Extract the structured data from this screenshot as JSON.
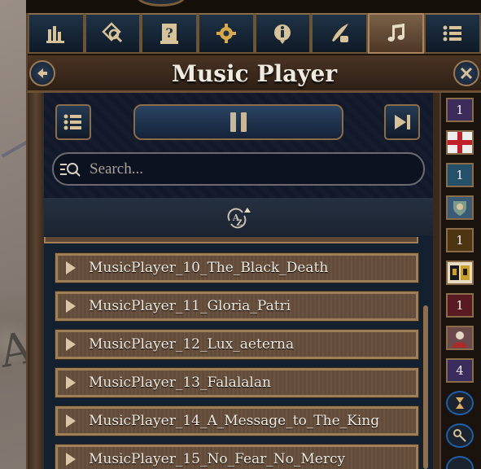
{
  "window": {
    "title": "Music Player"
  },
  "tabs": [
    {
      "name": "ledger",
      "icon": "bar-chart-icon",
      "active": false
    },
    {
      "name": "search-map",
      "icon": "map-search-icon",
      "active": false
    },
    {
      "name": "help",
      "icon": "question-scroll-icon",
      "active": false
    },
    {
      "name": "settings",
      "icon": "gear-icon",
      "active": false
    },
    {
      "name": "info",
      "icon": "info-icon",
      "active": false
    },
    {
      "name": "quill",
      "icon": "quill-ink-icon",
      "active": false
    },
    {
      "name": "music",
      "icon": "music-note-icon",
      "active": true
    },
    {
      "name": "menu",
      "icon": "list-icon",
      "active": false
    }
  ],
  "search": {
    "placeholder": "Search..."
  },
  "tracks": [
    "MusicPlayer_10_The_Black_Death",
    "MusicPlayer_11_Gloria_Patri",
    "MusicPlayer_12_Lux_aeterna",
    "MusicPlayer_13_Falalalan",
    "MusicPlayer_14_A_Message_to_The_King",
    "MusicPlayer_15_No_Fear_No_Mercy"
  ],
  "sidebar": {
    "badges": [
      {
        "value": "1",
        "color": "#3c2c5c"
      },
      {
        "value": "1",
        "color": "#24506a"
      },
      {
        "value": "1",
        "color": "#4e3512"
      },
      {
        "value": "1",
        "color": "#5a1a22"
      },
      {
        "value": "4",
        "color": "#3a2c5c"
      }
    ]
  },
  "colors": {
    "accent_gold": "#9e8058",
    "panel_bg": "#12192a",
    "title_text": "#f0ebe0"
  }
}
